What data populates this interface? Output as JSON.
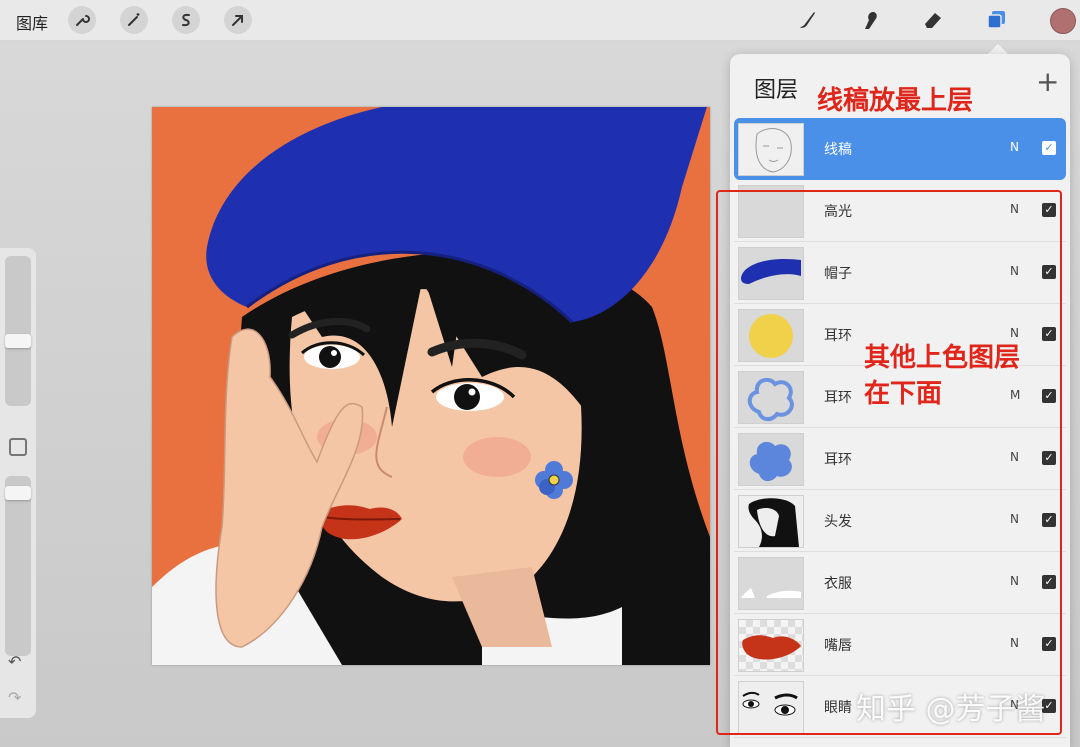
{
  "toolbar": {
    "gallery_label": "图库",
    "left_icons": [
      "wrench-icon",
      "magic-wand-icon",
      "selection-s-icon",
      "move-arrow-icon"
    ],
    "right_icons": [
      "brush-icon",
      "smudge-icon",
      "eraser-icon",
      "layers-icon"
    ],
    "current_color": "#b07070"
  },
  "layers_panel": {
    "title": "图层",
    "add_label": "+",
    "layers": [
      {
        "name": "线稿",
        "blend": "N",
        "visible": true,
        "selected": true
      },
      {
        "name": "高光",
        "blend": "N",
        "visible": true
      },
      {
        "name": "帽子",
        "blend": "N",
        "visible": true
      },
      {
        "name": "耳环",
        "blend": "N",
        "visible": true
      },
      {
        "name": "耳环",
        "blend": "M",
        "visible": true
      },
      {
        "name": "耳环",
        "blend": "N",
        "visible": true
      },
      {
        "name": "头发",
        "blend": "N",
        "visible": true
      },
      {
        "name": "衣服",
        "blend": "N",
        "visible": true
      },
      {
        "name": "嘴唇",
        "blend": "N",
        "visible": true
      },
      {
        "name": "眼睛",
        "blend": "N",
        "visible": true
      }
    ]
  },
  "annotations": {
    "top": "线稿放最上层",
    "middle_line1": "其他上色图层",
    "middle_line2": "在下面"
  },
  "watermark": "知乎 @芳子酱",
  "sidebar": {
    "undo": "↶",
    "redo": "↷"
  },
  "colors": {
    "accent_blue": "#4a90e8",
    "annotation_red": "#e0261b",
    "canvas_orange": "#e9713f"
  }
}
